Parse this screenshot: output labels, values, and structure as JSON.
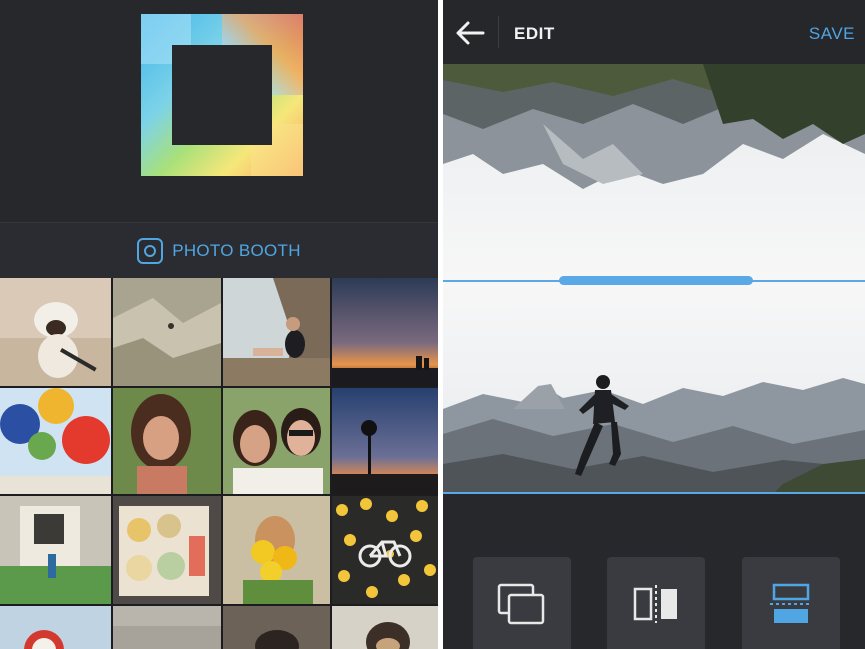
{
  "left_panel": {
    "photo_booth_label": "PHOTO BOOTH",
    "photos": [
      {
        "row": 1,
        "col": 1,
        "subject": "bulldog on rug"
      },
      {
        "row": 1,
        "col": 2,
        "subject": "rocky hillside hikers"
      },
      {
        "row": 1,
        "col": 3,
        "subject": "woman sitting on rocks"
      },
      {
        "row": 1,
        "col": 4,
        "subject": "sunset silhouettes"
      },
      {
        "row": 2,
        "col": 1,
        "subject": "balloons"
      },
      {
        "row": 2,
        "col": 2,
        "subject": "smiling woman"
      },
      {
        "row": 2,
        "col": 3,
        "subject": "couple selfie"
      },
      {
        "row": 2,
        "col": 4,
        "subject": "palm trees dusk"
      },
      {
        "row": 3,
        "col": 1,
        "subject": "child by house"
      },
      {
        "row": 3,
        "col": 2,
        "subject": "food box"
      },
      {
        "row": 3,
        "col": 3,
        "subject": "girl with flowers"
      },
      {
        "row": 3,
        "col": 4,
        "subject": "yellow leaves bicycle sign"
      },
      {
        "row": 4,
        "col": 1,
        "subject": "red sign"
      },
      {
        "row": 4,
        "col": 2,
        "subject": "pavement"
      },
      {
        "row": 4,
        "col": 3,
        "subject": "dog"
      },
      {
        "row": 4,
        "col": 4,
        "subject": "dog portrait"
      }
    ]
  },
  "right_panel": {
    "title": "EDIT",
    "save_label": "SAVE",
    "tools": [
      "replace-icon",
      "mirror-icon",
      "flip-icon"
    ],
    "accent_color": "#4fa6e3"
  }
}
